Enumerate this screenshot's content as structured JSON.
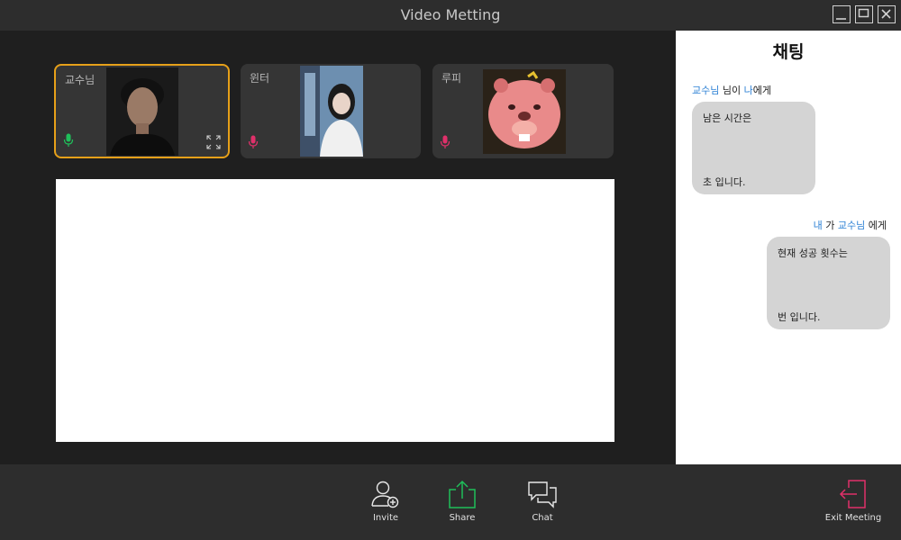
{
  "window": {
    "title": "Video Metting"
  },
  "participants": [
    {
      "name": "교수님",
      "mic": "on",
      "active": true
    },
    {
      "name": "윈터",
      "mic": "off",
      "active": false
    },
    {
      "name": "루피",
      "mic": "off",
      "active": false
    }
  ],
  "chat": {
    "title": "채팅",
    "messages": [
      {
        "from": "교수님",
        "from_suffix": " 님이 ",
        "to": "나",
        "to_suffix": "에게",
        "line1": "남은 시간은",
        "line2": "초 입니다.",
        "side": "left"
      },
      {
        "from": "내",
        "from_suffix": " 가 ",
        "to": "교수님",
        "to_suffix": " 에게",
        "line1": "현재 성공 횟수는",
        "line2": "번 입니다.",
        "side": "right"
      }
    ]
  },
  "toolbar": {
    "invite": "Invite",
    "share": "Share",
    "chat": "Chat",
    "exit": "Exit Meeting"
  },
  "colors": {
    "accent_active_border": "#e6a019",
    "mic_on": "#1fbf5a",
    "mic_off": "#e0306a",
    "share_icon": "#1fbf5a",
    "exit_icon": "#e0306a",
    "highlight_text": "#2a7fd4"
  }
}
